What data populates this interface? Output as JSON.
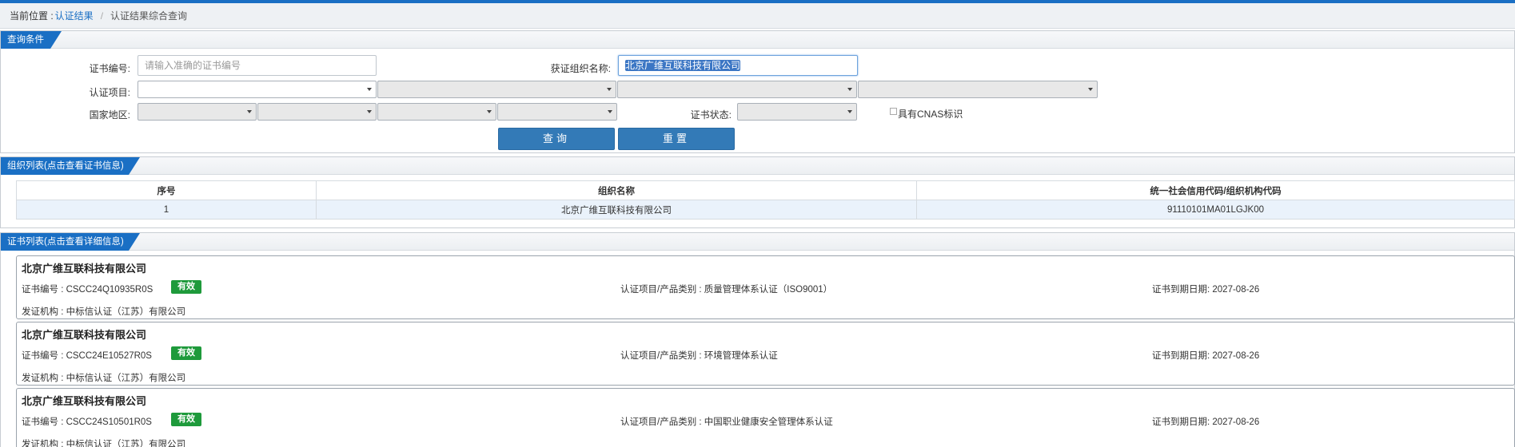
{
  "breadcrumb": {
    "prefix": "当前位置 :",
    "link": "认证结果",
    "separator": "/",
    "current": "认证结果综合查询"
  },
  "query": {
    "section_title": "查询条件",
    "cert_no_label": "证书编号:",
    "cert_no_placeholder": "请输入准确的证书编号",
    "org_name_label": "获证组织名称:",
    "org_name_value": "北京广维互联科技有限公司",
    "cert_item_label": "认证项目:",
    "region_label": "国家地区:",
    "status_label": "证书状态:",
    "cnas_label": "具有CNAS标识",
    "search_button": "查询",
    "reset_button": "重置"
  },
  "org_list": {
    "section_title": "组织列表(点击查看证书信息)",
    "columns": [
      "序号",
      "组织名称",
      "统一社会信用代码/组织机构代码"
    ],
    "rows": [
      [
        "1",
        "北京广维互联科技有限公司",
        "91110101MA01LGJK00"
      ]
    ]
  },
  "cert_list": {
    "section_title": "证书列表(点击查看详细信息)",
    "items": [
      {
        "org": "北京广维互联科技有限公司",
        "cert_no": "证书编号 : CSCC24Q10935R0S",
        "status": "有效",
        "item": "认证项目/产品类别 : 质量管理体系认证（ISO9001）",
        "expiry": "证书到期日期: 2027-08-26",
        "issuer": "发证机构 : 中标信认证（江苏）有限公司"
      },
      {
        "org": "北京广维互联科技有限公司",
        "cert_no": "证书编号 : CSCC24E10527R0S",
        "status": "有效",
        "item": "认证项目/产品类别 : 环境管理体系认证",
        "expiry": "证书到期日期: 2027-08-26",
        "issuer": "发证机构 : 中标信认证（江苏）有限公司"
      },
      {
        "org": "北京广维互联科技有限公司",
        "cert_no": "证书编号 : CSCC24S10501R0S",
        "status": "有效",
        "item": "认证项目/产品类别 : 中国职业健康安全管理体系认证",
        "expiry": "证书到期日期: 2027-08-26",
        "issuer": "发证机构 : 中标信认证（江苏）有限公司"
      }
    ]
  }
}
